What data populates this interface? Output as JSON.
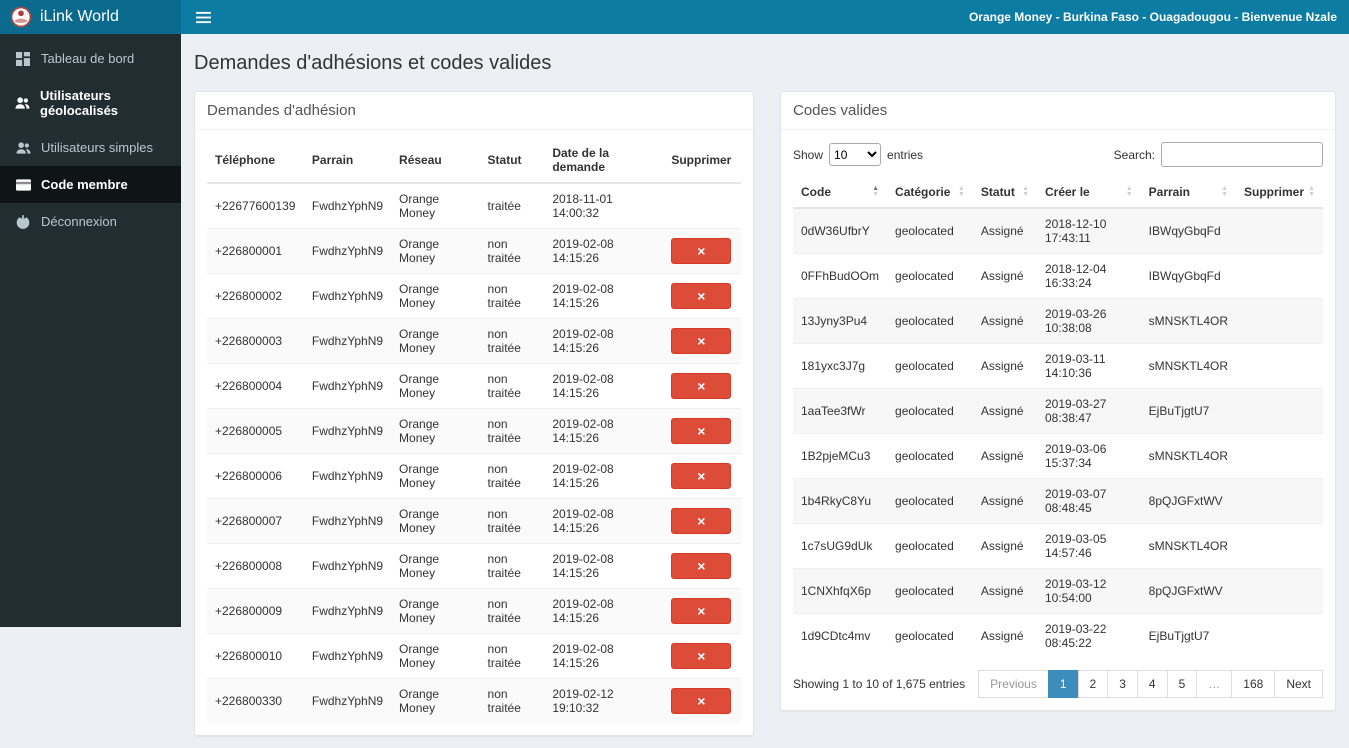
{
  "colors": {
    "topbar": "#0c7ca3",
    "topbar_brand": "#0a6a8e",
    "sidebar": "#222d32",
    "sidebar_active": "#0f1417",
    "danger": "#dd4b39",
    "pagination_active": "#3c8dbc",
    "content_bg": "#ecf0f5"
  },
  "topbar": {
    "brand": "iLink World",
    "right_text": "Orange Money - Burkina Faso - Ouagadougou - Bienvenue Nzale"
  },
  "sidebar": {
    "items": [
      {
        "id": "tableau-de-bord",
        "label": "Tableau de bord",
        "icon": "dashboard",
        "active": false,
        "bold": false
      },
      {
        "id": "utilisateurs-geolocalises",
        "label": "Utilisateurs géolocalisés",
        "icon": "users",
        "active": false,
        "bold": true
      },
      {
        "id": "utilisateurs-simples",
        "label": "Utilisateurs simples",
        "icon": "users",
        "active": false,
        "bold": false
      },
      {
        "id": "code-membre",
        "label": "Code membre",
        "icon": "card",
        "active": true,
        "bold": true
      },
      {
        "id": "deconnexion",
        "label": "Déconnexion",
        "icon": "power",
        "active": false,
        "bold": false
      }
    ]
  },
  "page": {
    "title": "Demandes d'adhésions et codes valides"
  },
  "adhesions": {
    "panel_title": "Demandes d'adhésion",
    "headers": [
      "Téléphone",
      "Parrain",
      "Réseau",
      "Statut",
      "Date de la demande",
      "Supprimer"
    ],
    "rows": [
      {
        "telephone": "+22677600139",
        "parrain": "FwdhzYphN9",
        "reseau": "Orange Money",
        "statut": "traitée",
        "date": "2018-11-01 14:00:32",
        "deletable": false
      },
      {
        "telephone": "+226800001",
        "parrain": "FwdhzYphN9",
        "reseau": "Orange Money",
        "statut": "non traitée",
        "date": "2019-02-08 14:15:26",
        "deletable": true
      },
      {
        "telephone": "+226800002",
        "parrain": "FwdhzYphN9",
        "reseau": "Orange Money",
        "statut": "non traitée",
        "date": "2019-02-08 14:15:26",
        "deletable": true
      },
      {
        "telephone": "+226800003",
        "parrain": "FwdhzYphN9",
        "reseau": "Orange Money",
        "statut": "non traitée",
        "date": "2019-02-08 14:15:26",
        "deletable": true
      },
      {
        "telephone": "+226800004",
        "parrain": "FwdhzYphN9",
        "reseau": "Orange Money",
        "statut": "non traitée",
        "date": "2019-02-08 14:15:26",
        "deletable": true
      },
      {
        "telephone": "+226800005",
        "parrain": "FwdhzYphN9",
        "reseau": "Orange Money",
        "statut": "non traitée",
        "date": "2019-02-08 14:15:26",
        "deletable": true
      },
      {
        "telephone": "+226800006",
        "parrain": "FwdhzYphN9",
        "reseau": "Orange Money",
        "statut": "non traitée",
        "date": "2019-02-08 14:15:26",
        "deletable": true
      },
      {
        "telephone": "+226800007",
        "parrain": "FwdhzYphN9",
        "reseau": "Orange Money",
        "statut": "non traitée",
        "date": "2019-02-08 14:15:26",
        "deletable": true
      },
      {
        "telephone": "+226800008",
        "parrain": "FwdhzYphN9",
        "reseau": "Orange Money",
        "statut": "non traitée",
        "date": "2019-02-08 14:15:26",
        "deletable": true
      },
      {
        "telephone": "+226800009",
        "parrain": "FwdhzYphN9",
        "reseau": "Orange Money",
        "statut": "non traitée",
        "date": "2019-02-08 14:15:26",
        "deletable": true
      },
      {
        "telephone": "+226800010",
        "parrain": "FwdhzYphN9",
        "reseau": "Orange Money",
        "statut": "non traitée",
        "date": "2019-02-08 14:15:26",
        "deletable": true
      },
      {
        "telephone": "+226800330",
        "parrain": "FwdhzYphN9",
        "reseau": "Orange Money",
        "statut": "non traitée",
        "date": "2019-02-12 19:10:32",
        "deletable": true
      }
    ]
  },
  "codes": {
    "panel_title": "Codes valides",
    "show_label": "Show",
    "entries_label": "entries",
    "page_length": "10",
    "page_length_options": [
      "10"
    ],
    "search_label": "Search:",
    "search_value": "",
    "headers": [
      "Code",
      "Catégorie",
      "Statut",
      "Créer le",
      "Parrain",
      "Supprimer"
    ],
    "rows": [
      {
        "code": "0dW36UfbrY",
        "categorie": "geolocated",
        "statut": "Assigné",
        "creer_le": "2018-12-10 17:43:11",
        "parrain": "IBWqyGbqFd"
      },
      {
        "code": "0FFhBudOOm",
        "categorie": "geolocated",
        "statut": "Assigné",
        "creer_le": "2018-12-04 16:33:24",
        "parrain": "IBWqyGbqFd"
      },
      {
        "code": "13Jyny3Pu4",
        "categorie": "geolocated",
        "statut": "Assigné",
        "creer_le": "2019-03-26 10:38:08",
        "parrain": "sMNSKTL4OR"
      },
      {
        "code": "181yxc3J7g",
        "categorie": "geolocated",
        "statut": "Assigné",
        "creer_le": "2019-03-11 14:10:36",
        "parrain": "sMNSKTL4OR"
      },
      {
        "code": "1aaTee3fWr",
        "categorie": "geolocated",
        "statut": "Assigné",
        "creer_le": "2019-03-27 08:38:47",
        "parrain": "EjBuTjgtU7"
      },
      {
        "code": "1B2pjeMCu3",
        "categorie": "geolocated",
        "statut": "Assigné",
        "creer_le": "2019-03-06 15:37:34",
        "parrain": "sMNSKTL4OR"
      },
      {
        "code": "1b4RkyC8Yu",
        "categorie": "geolocated",
        "statut": "Assigné",
        "creer_le": "2019-03-07 08:48:45",
        "parrain": "8pQJGFxtWV"
      },
      {
        "code": "1c7sUG9dUk",
        "categorie": "geolocated",
        "statut": "Assigné",
        "creer_le": "2019-03-05 14:57:46",
        "parrain": "sMNSKTL4OR"
      },
      {
        "code": "1CNXhfqX6p",
        "categorie": "geolocated",
        "statut": "Assigné",
        "creer_le": "2019-03-12 10:54:00",
        "parrain": "8pQJGFxtWV"
      },
      {
        "code": "1d9CDtc4mv",
        "categorie": "geolocated",
        "statut": "Assigné",
        "creer_le": "2019-03-22 08:45:22",
        "parrain": "EjBuTjgtU7"
      }
    ],
    "info": "Showing 1 to 10 of 1,675 entries",
    "pagination": [
      {
        "id": "previous",
        "label": "Previous",
        "active": false,
        "disabled": true
      },
      {
        "id": "1",
        "label": "1",
        "active": true,
        "disabled": false
      },
      {
        "id": "2",
        "label": "2",
        "active": false,
        "disabled": false
      },
      {
        "id": "3",
        "label": "3",
        "active": false,
        "disabled": false
      },
      {
        "id": "4",
        "label": "4",
        "active": false,
        "disabled": false
      },
      {
        "id": "5",
        "label": "5",
        "active": false,
        "disabled": false
      },
      {
        "id": "ellipsis",
        "label": "…",
        "active": false,
        "disabled": true
      },
      {
        "id": "168",
        "label": "168",
        "active": false,
        "disabled": false
      },
      {
        "id": "next",
        "label": "Next",
        "active": false,
        "disabled": false
      }
    ]
  }
}
